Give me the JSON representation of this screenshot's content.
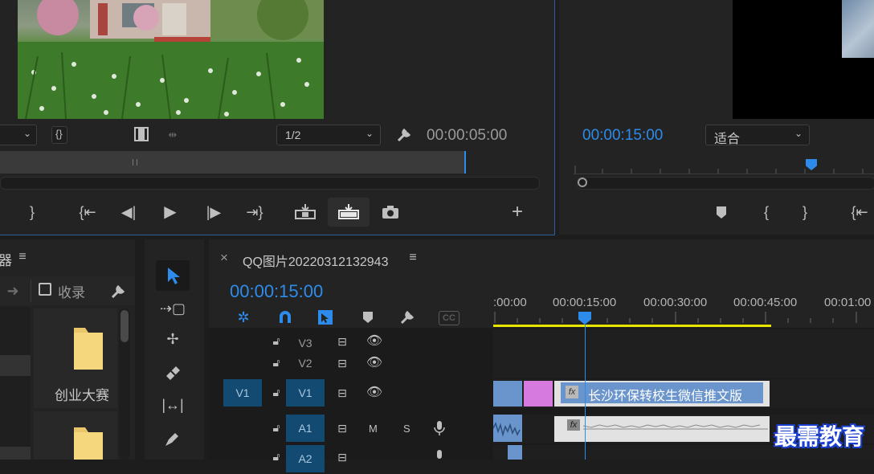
{
  "source_monitor": {
    "dropdown_value": "",
    "resolution": "1/2",
    "timecode": "00:00:05:00"
  },
  "program_monitor": {
    "timecode": "00:00:15:00",
    "fit": "适合"
  },
  "project_panel": {
    "title_fragment": "器",
    "favorites_label": "收录",
    "bin_label": "创业大赛"
  },
  "timeline": {
    "close_glyph": "×",
    "sequence_name": "QQ图片20220312132943",
    "timecode": "00:00:15:00",
    "ruler": [
      ":00:00",
      "00:00:15:00",
      "00:00:30:00",
      "00:00:45:00",
      "00:01:00"
    ],
    "tracks": [
      {
        "src": "",
        "name": "V3"
      },
      {
        "src": "",
        "name": "V2"
      },
      {
        "src": "V1",
        "name": "V1"
      },
      {
        "src": "",
        "name": "A1",
        "m": "M",
        "s": "S"
      },
      {
        "src": "",
        "name": "A2"
      }
    ],
    "title_clip": "长沙环保转校生微信推文版",
    "fx_label": "fx",
    "cc_label": "CC"
  },
  "watermark": "最需教育",
  "colors": {
    "accent_blue": "#2d8ceb",
    "track_blue": "#134a72",
    "clip_blue": "#6a95cc",
    "clip_pink": "#d67ae0",
    "work_area": "#e8e400"
  }
}
